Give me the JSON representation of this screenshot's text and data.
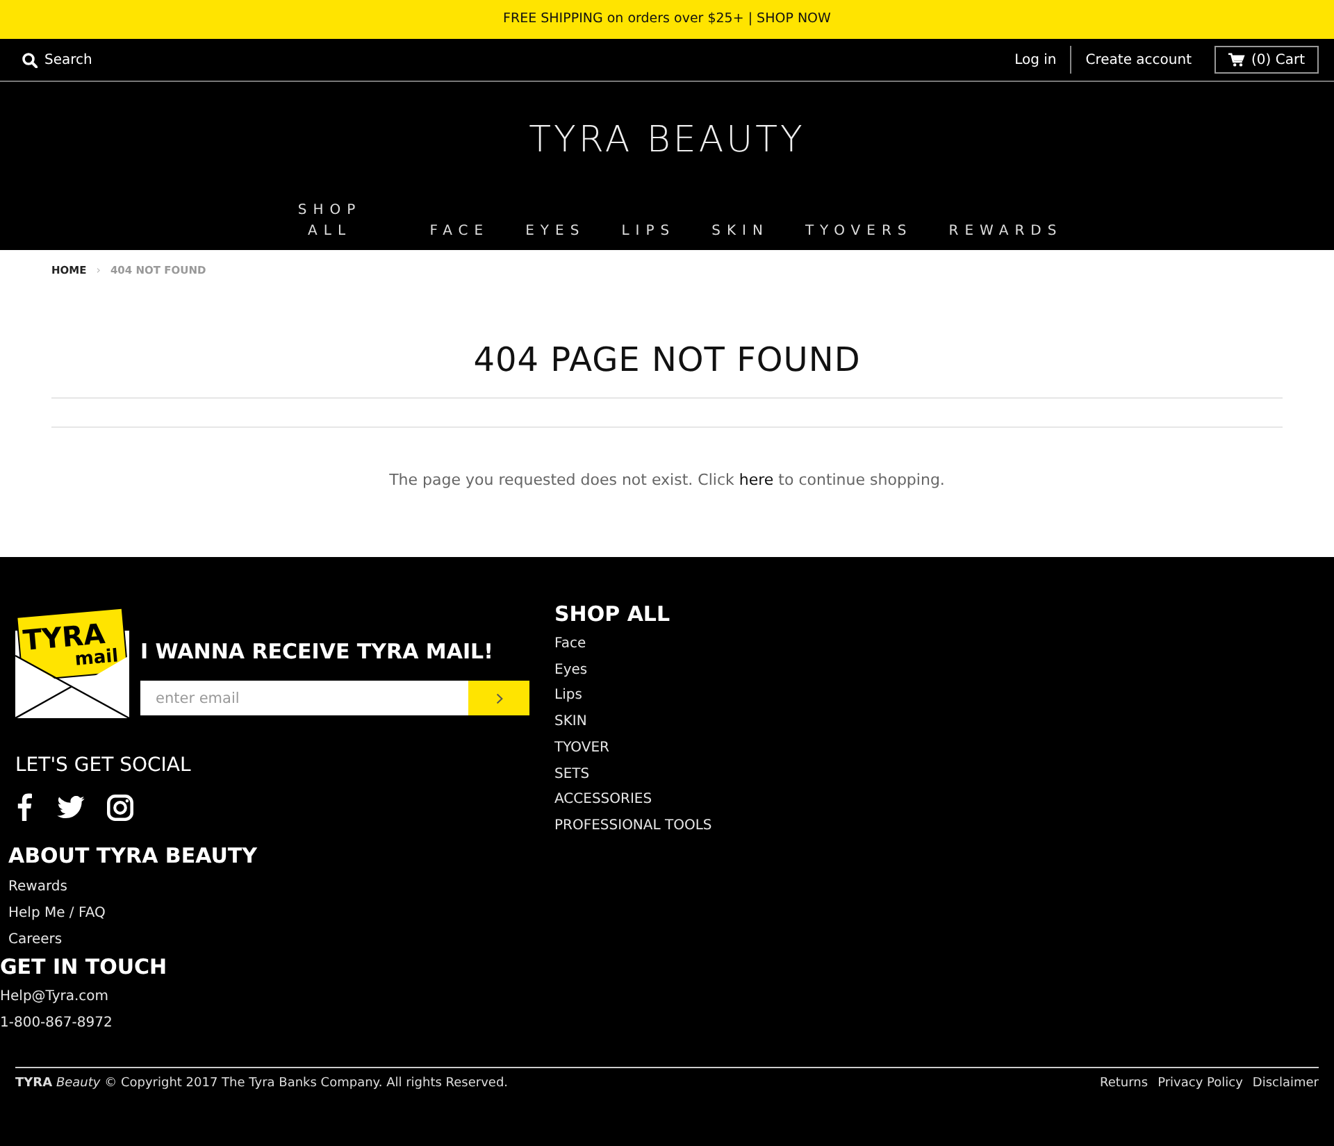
{
  "announcement": {
    "text": "FREE SHIPPING on orders over $25+ | SHOP NOW"
  },
  "top_bar": {
    "search": "Search",
    "account_links": [
      "Log in",
      "Create account"
    ],
    "cart": "(0) Cart"
  },
  "logo": "TYRA BEAUTY",
  "nav": [
    "SHOP ALL",
    "FACE",
    "EYES",
    "LIPS",
    "SKIN",
    "TYOVERS",
    "REWARDS"
  ],
  "breadcrumb": {
    "separator": "›",
    "items": [
      {
        "label": "HOME",
        "current": false
      },
      {
        "label": "404 NOT FOUND",
        "current": true
      }
    ]
  },
  "content": {
    "title": "404 PAGE NOT FOUND",
    "message": {
      "before": "The page you requested does not exist. Click ",
      "link": "here",
      "after": " to continue shopping."
    }
  },
  "footer": {
    "newsletter": {
      "logo": {
        "line_1": "TYRA",
        "line_2": "mail"
      },
      "heading": "I WANNA RECEIVE TYRA MAIL!",
      "placeholder": "enter email"
    },
    "social": {
      "heading": "LET'S GET SOCIAL",
      "networks": [
        {
          "kind": "facebook"
        },
        {
          "kind": "twitter"
        },
        {
          "kind": "instagram"
        }
      ]
    },
    "about": {
      "heading": "ABOUT TYRA BEAUTY",
      "links": [
        "Rewards",
        "Help Me / FAQ",
        "Careers"
      ]
    },
    "contact": {
      "heading": "GET IN TOUCH",
      "lines": [
        "Help@Tyra.com",
        "1-800-867-8972"
      ]
    },
    "shop": {
      "heading": "SHOP ALL",
      "links": [
        "Face",
        "Eyes",
        "Lips",
        "SKIN",
        "TYOVER",
        "SETS",
        "ACCESSORIES",
        "PROFESSIONAL TOOLS"
      ]
    },
    "copyright": "**TYRA** *Beauty* © Copyright 2017 The Tyra Banks Company. All rights Reserved.",
    "legal_links": [
      "Returns",
      "Privacy Policy",
      "Disclaimer"
    ]
  }
}
